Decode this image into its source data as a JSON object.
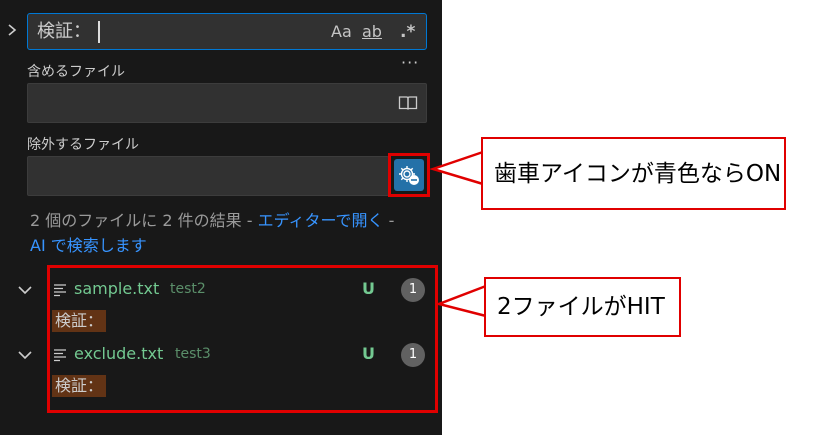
{
  "search": {
    "query": "検証：",
    "match_case_label": "Aa",
    "whole_word_label": "ab",
    "regex_label": ".*"
  },
  "more_label": "···",
  "include": {
    "label": "含めるファイル",
    "value": ""
  },
  "exclude": {
    "label": "除外するファイル",
    "value": ""
  },
  "summary": {
    "text": "2 個のファイルに 2 件の結果 - ",
    "open_editor_link": "エディターで開く",
    "dash": " -",
    "ai_search_link": "AI で検索します"
  },
  "results": [
    {
      "filename": "sample.txt",
      "folder": "test2",
      "status": "U",
      "count": "1",
      "match": "検証："
    },
    {
      "filename": "exclude.txt",
      "folder": "test3",
      "status": "U",
      "count": "1",
      "match": "検証："
    }
  ],
  "annotations": {
    "gear_note": "歯車アイコンが青色ならON",
    "results_note": "2ファイルがHIT"
  },
  "colors": {
    "panel_bg": "#181818",
    "input_bg": "#313131",
    "focus_border": "#0078d4",
    "link": "#3794ff",
    "git_untracked": "#73c991",
    "gear_active_bg": "#2471a8",
    "match_highlight": "#623315",
    "annotation_red": "#e00000"
  }
}
